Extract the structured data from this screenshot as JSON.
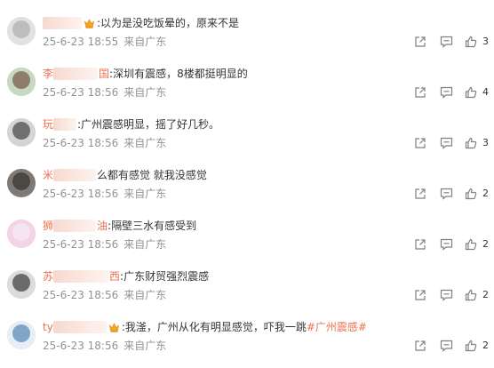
{
  "comments": [
    {
      "name_suffix": "",
      "crown": true,
      "text": ":以为是没吃饭晕的，原来不是",
      "tag": "",
      "date": "25-6-23 18:55",
      "location": "来自广东",
      "likes": "3",
      "avatar_colors": [
        "#e2e2e2",
        "#bdbdbd"
      ]
    },
    {
      "name_prefix": "李",
      "name_suffix": "国",
      "crown": false,
      "text": ":深圳有震感，8楼都挺明显的",
      "tag": "",
      "date": "25-6-23 18:56",
      "location": "来自广东",
      "likes": "4",
      "avatar_colors": [
        "#c9d8c2",
        "#8e7d6a"
      ]
    },
    {
      "name_prefix": "玩",
      "name_suffix": "",
      "crown": false,
      "text": ":广州震感明显，摇了好几秒。",
      "tag": "",
      "date": "25-6-23 18:56",
      "location": "来自广东",
      "likes": "3",
      "avatar_colors": [
        "#d5d5d5",
        "#6f6f6f"
      ]
    },
    {
      "name_prefix": "米",
      "name_suffix": "",
      "crown": false,
      "text": "么都有感觉 就我没感觉",
      "tag": "",
      "date": "25-6-23 18:56",
      "location": "来自广东",
      "likes": "2",
      "avatar_colors": [
        "#7f7a76",
        "#4b4743"
      ]
    },
    {
      "name_prefix": "狮",
      "name_suffix": "油",
      "crown": false,
      "text": ":隔壁三水有感受到",
      "tag": "",
      "date": "25-6-23 18:56",
      "location": "来自广东",
      "likes": "2",
      "avatar_colors": [
        "#f3d2ea",
        "#f7e4f1"
      ]
    },
    {
      "name_prefix": "苏",
      "name_suffix": "西",
      "crown": false,
      "text": ":广东财贸强烈震感",
      "tag": "",
      "date": "25-6-23 18:56",
      "location": "来自广东",
      "likes": "2",
      "avatar_colors": [
        "#dcdcdc",
        "#6b6b6b"
      ]
    },
    {
      "name_prefix": "ty",
      "name_suffix": "",
      "crown": true,
      "text": ":我滏，广州从化有明显感觉，吓我一跳",
      "tag": "#广州震感#",
      "date": "25-6-23 18:56",
      "location": "来自广东",
      "likes": "2",
      "avatar_colors": [
        "#e7eef5",
        "#7fa6c9"
      ]
    }
  ],
  "colors": {
    "nickname": "#eb7350",
    "meta": "#939393",
    "icon": "#808080"
  },
  "icons": {
    "share": "share-icon",
    "comment": "comment-icon",
    "like": "like-icon",
    "crown": "crown-icon"
  }
}
